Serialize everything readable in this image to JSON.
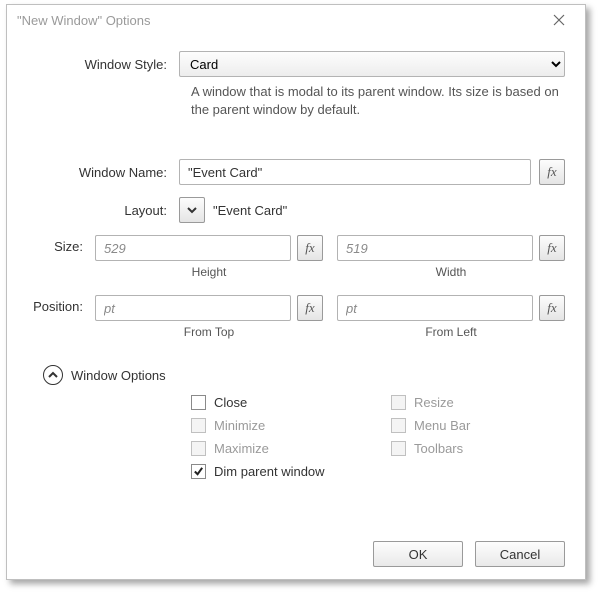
{
  "title": "\"New Window\" Options",
  "labels": {
    "window_style": "Window Style:",
    "window_name": "Window Name:",
    "layout": "Layout:",
    "size": "Size:",
    "position": "Position:",
    "window_options": "Window Options"
  },
  "style": {
    "selected": "Card",
    "description": "A window that is modal to its parent window. Its size is based on the parent window by default."
  },
  "window_name": "\"Event Card\"",
  "layout_value": "\"Event Card\"",
  "size": {
    "height": "529",
    "width": "519",
    "height_label": "Height",
    "width_label": "Width"
  },
  "position": {
    "from_top": "pt",
    "from_left": "pt",
    "from_top_label": "From Top",
    "from_left_label": "From Left"
  },
  "options": {
    "close": {
      "label": "Close",
      "checked": false,
      "enabled": true
    },
    "resize": {
      "label": "Resize",
      "checked": false,
      "enabled": false
    },
    "minimize": {
      "label": "Minimize",
      "checked": false,
      "enabled": false
    },
    "menu_bar": {
      "label": "Menu Bar",
      "checked": false,
      "enabled": false
    },
    "maximize": {
      "label": "Maximize",
      "checked": false,
      "enabled": false
    },
    "toolbars": {
      "label": "Toolbars",
      "checked": false,
      "enabled": false
    },
    "dim_parent": {
      "label": "Dim parent window",
      "checked": true,
      "enabled": true
    }
  },
  "buttons": {
    "ok": "OK",
    "cancel": "Cancel"
  },
  "fx_glyph": "fx"
}
